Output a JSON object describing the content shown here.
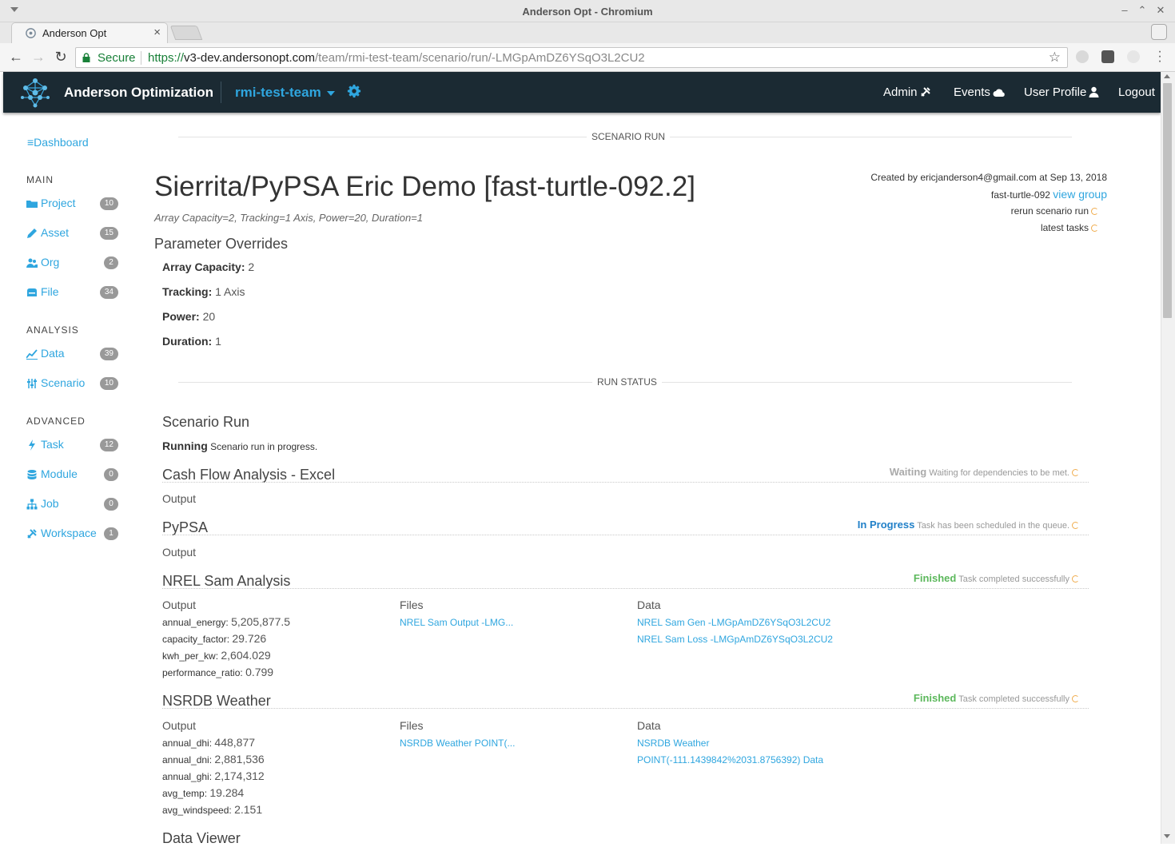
{
  "browser": {
    "window_title": "Anderson Opt - Chromium",
    "tab_title": "Anderson Opt",
    "secure_label": "Secure",
    "url_scheme": "https://",
    "url_host": "v3-dev.andersonopt.com",
    "url_path": "/team/rmi-test-team/scenario/run/-LMGpAmDZ6YSqO3L2CU2"
  },
  "navbar": {
    "brand": "Anderson Optimization",
    "team": "rmi-test-team",
    "links": {
      "admin": "Admin",
      "events": "Events",
      "profile": "User Profile",
      "logout": "Logout"
    }
  },
  "sidebar": {
    "dashboard": "Dashboard",
    "sections": [
      {
        "title": "MAIN",
        "items": [
          {
            "label": "Project",
            "count": "10",
            "icon": "folder-icon"
          },
          {
            "label": "Asset",
            "count": "15",
            "icon": "pencil-icon"
          },
          {
            "label": "Org",
            "count": "2",
            "icon": "users-icon"
          },
          {
            "label": "File",
            "count": "34",
            "icon": "file-icon"
          }
        ]
      },
      {
        "title": "ANALYSIS",
        "items": [
          {
            "label": "Data",
            "count": "39",
            "icon": "chart-line-icon"
          },
          {
            "label": "Scenario",
            "count": "10",
            "icon": "sliders-icon"
          }
        ]
      },
      {
        "title": "ADVANCED",
        "items": [
          {
            "label": "Task",
            "count": "12",
            "icon": "bolt-icon"
          },
          {
            "label": "Module",
            "count": "0",
            "icon": "database-icon"
          },
          {
            "label": "Job",
            "count": "0",
            "icon": "sitemap-icon"
          },
          {
            "label": "Workspace",
            "count": "1",
            "icon": "tools-icon"
          }
        ]
      }
    ]
  },
  "main": {
    "section_scenario_run": "SCENARIO RUN",
    "title": "Sierrita/PyPSA Eric Demo [fast-turtle-092.2]",
    "subtitle": "Array Capacity=2, Tracking=1 Axis, Power=20, Duration=1",
    "meta": {
      "created_by": "Created by ericjanderson4@gmail.com at Sep 13, 2018",
      "group_name": "fast-turtle-092",
      "view_group": "view group",
      "rerun": "rerun scenario run",
      "latest_tasks": "latest tasks"
    },
    "overrides_title": "Parameter Overrides",
    "overrides": [
      {
        "key": "Array Capacity:",
        "value": "2"
      },
      {
        "key": "Tracking:",
        "value": "1 Axis"
      },
      {
        "key": "Power:",
        "value": "20"
      },
      {
        "key": "Duration:",
        "value": "1"
      }
    ],
    "section_run_status": "RUN STATUS",
    "scenario_run": {
      "title": "Scenario Run",
      "status": "Running",
      "message": "Scenario run in progress."
    },
    "column_labels": {
      "output": "Output",
      "files": "Files",
      "data": "Data"
    },
    "tasks": [
      {
        "title": "Cash Flow Analysis - Excel",
        "status": "Waiting",
        "message": "Waiting for dependencies to be met."
      },
      {
        "title": "PyPSA",
        "status": "In Progress",
        "message": "Task has been scheduled in the queue."
      },
      {
        "title": "NREL Sam Analysis",
        "status": "Finished",
        "message": "Task completed successfully",
        "outputs": [
          {
            "key": "annual_energy:",
            "value": "5,205,877.5"
          },
          {
            "key": "capacity_factor:",
            "value": "29.726"
          },
          {
            "key": "kwh_per_kw:",
            "value": "2,604.029"
          },
          {
            "key": "performance_ratio:",
            "value": "0.799"
          }
        ],
        "files": [
          "NREL Sam Output -LMG..."
        ],
        "data": [
          "NREL Sam Gen -LMGpAmDZ6YSqO3L2CU2",
          "NREL Sam Loss -LMGpAmDZ6YSqO3L2CU2"
        ]
      },
      {
        "title": "NSRDB Weather",
        "status": "Finished",
        "message": "Task completed successfully",
        "outputs": [
          {
            "key": "annual_dhi:",
            "value": "448,877"
          },
          {
            "key": "annual_dni:",
            "value": "2,881,536"
          },
          {
            "key": "annual_ghi:",
            "value": "2,174,312"
          },
          {
            "key": "avg_temp:",
            "value": "19.284"
          },
          {
            "key": "avg_windspeed:",
            "value": "2.151"
          }
        ],
        "files": [
          "NSRDB Weather POINT(..."
        ],
        "data": [
          "NSRDB Weather",
          "POINT(-111.1439842%2031.8756392) Data"
        ]
      }
    ],
    "data_viewer": "Data Viewer"
  },
  "colors": {
    "navbar_bg": "#1b2a33",
    "accent": "#2fa6df",
    "finished": "#5cb85c",
    "in_progress": "#2180c8",
    "waiting": "#aaaaaa"
  }
}
